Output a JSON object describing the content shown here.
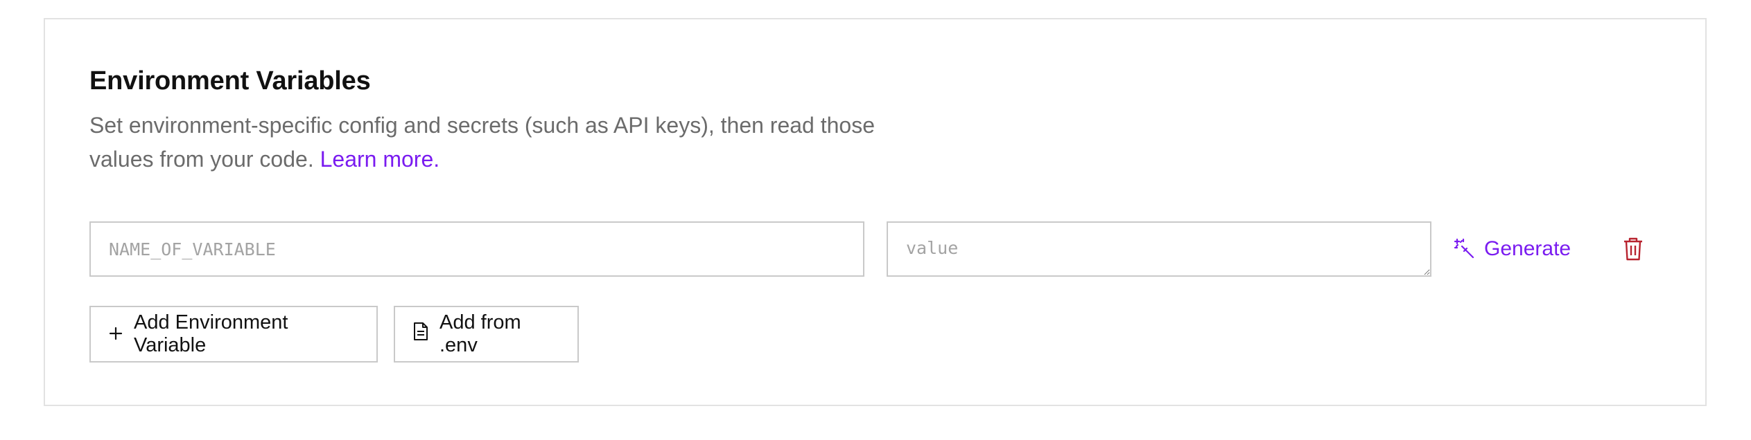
{
  "section": {
    "title": "Environment Variables",
    "description": "Set environment-specific config and secrets (such as API keys), then read those values from your code.",
    "learn_more_label": "Learn more."
  },
  "env_row": {
    "name_placeholder": "NAME_OF_VARIABLE",
    "value_placeholder": "value",
    "generate_label": "Generate"
  },
  "actions": {
    "add_variable_label": "Add Environment Variable",
    "add_from_env_label": "Add from .env"
  },
  "colors": {
    "accent": "#7a1bf0",
    "danger": "#b8232f",
    "border": "#c9c9c9",
    "muted_text": "#6b6b6b"
  },
  "icons": {
    "generate": "magic-wand-icon",
    "delete": "trash-icon",
    "add": "plus-icon",
    "file": "file-icon"
  }
}
